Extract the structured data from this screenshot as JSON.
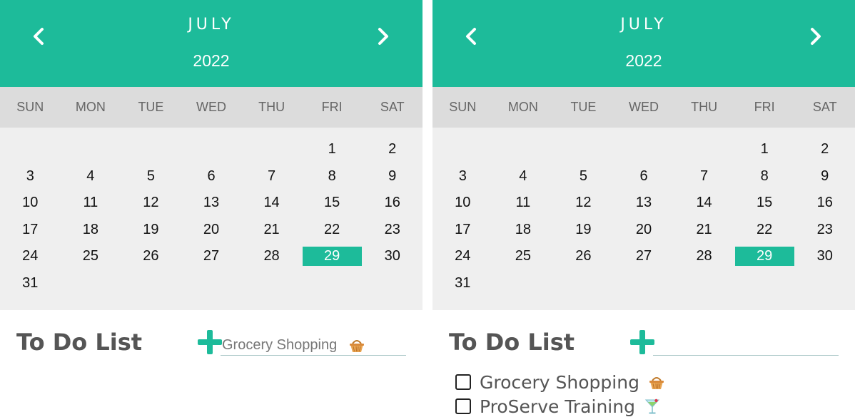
{
  "colors": {
    "accent": "#1dbb9a",
    "weekday_bg": "#dcdcdc",
    "grid_bg": "#efefef",
    "title_text": "#555555"
  },
  "panels": [
    {
      "calendar": {
        "month": "JULY",
        "year": "2022",
        "prev_icon": "chevron-left-icon",
        "next_icon": "chevron-right-icon",
        "weekdays": [
          "SUN",
          "MON",
          "TUE",
          "WED",
          "THU",
          "FRI",
          "SAT"
        ],
        "first_weekday_index": 5,
        "days": [
          "1",
          "2",
          "3",
          "4",
          "5",
          "6",
          "7",
          "8",
          "9",
          "10",
          "11",
          "12",
          "13",
          "14",
          "15",
          "16",
          "17",
          "18",
          "19",
          "20",
          "21",
          "22",
          "23",
          "24",
          "25",
          "26",
          "27",
          "28",
          "29",
          "30",
          "31"
        ],
        "selected_day": "29"
      },
      "todo": {
        "title": "To Do List",
        "add_icon": "plus-icon",
        "input_value": "Grocery Shopping",
        "input_icon": "basket-icon",
        "items": []
      }
    },
    {
      "calendar": {
        "month": "JULY",
        "year": "2022",
        "prev_icon": "chevron-left-icon",
        "next_icon": "chevron-right-icon",
        "weekdays": [
          "SUN",
          "MON",
          "TUE",
          "WED",
          "THU",
          "FRI",
          "SAT"
        ],
        "first_weekday_index": 5,
        "days": [
          "1",
          "2",
          "3",
          "4",
          "5",
          "6",
          "7",
          "8",
          "9",
          "10",
          "11",
          "12",
          "13",
          "14",
          "15",
          "16",
          "17",
          "18",
          "19",
          "20",
          "21",
          "22",
          "23",
          "24",
          "25",
          "26",
          "27",
          "28",
          "29",
          "30",
          "31"
        ],
        "selected_day": "29"
      },
      "todo": {
        "title": "To Do List",
        "add_icon": "plus-icon",
        "input_value": "",
        "input_icon": "",
        "items": [
          {
            "label": "Grocery Shopping",
            "icon": "basket-icon",
            "checked": false
          },
          {
            "label": "ProServe Training",
            "icon": "cocktail-icon",
            "checked": false
          }
        ]
      }
    }
  ]
}
